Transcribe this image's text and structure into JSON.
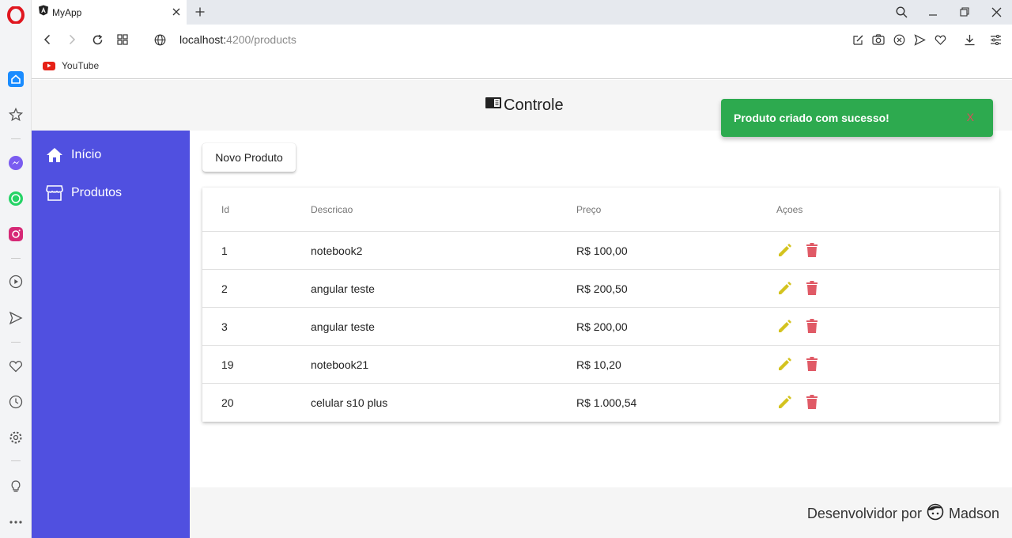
{
  "browser": {
    "tab_title": "MyApp",
    "url_host": "localhost:",
    "url_path": "4200/products",
    "bookmark_youtube": "YouTube"
  },
  "app": {
    "title": "Controle",
    "new_product_button": "Novo Produto",
    "footer_prefix": "Desenvolvidor por",
    "footer_author": "Madson"
  },
  "sidebar": {
    "items": [
      {
        "label": "Início",
        "icon": "home-icon"
      },
      {
        "label": "Produtos",
        "icon": "storefront-icon"
      }
    ],
    "color": "#5050e0"
  },
  "table": {
    "headers": [
      "Id",
      "Descricao",
      "Preço",
      "Açoes"
    ],
    "rows": [
      {
        "id": "1",
        "descricao": "notebook2",
        "preco": "R$ 100,00"
      },
      {
        "id": "2",
        "descricao": "angular teste",
        "preco": "R$ 200,50"
      },
      {
        "id": "3",
        "descricao": "angular teste",
        "preco": "R$ 200,00"
      },
      {
        "id": "19",
        "descricao": "notebook21",
        "preco": "R$ 10,20"
      },
      {
        "id": "20",
        "descricao": "celular s10 plus",
        "preco": "R$ 1.000,54"
      }
    ],
    "edit_icon_color": "#d4c31f",
    "delete_icon_color": "#e05a66"
  },
  "toast": {
    "message": "Produto criado com sucesso!",
    "close_label": "X",
    "color": "#2daa4f"
  }
}
